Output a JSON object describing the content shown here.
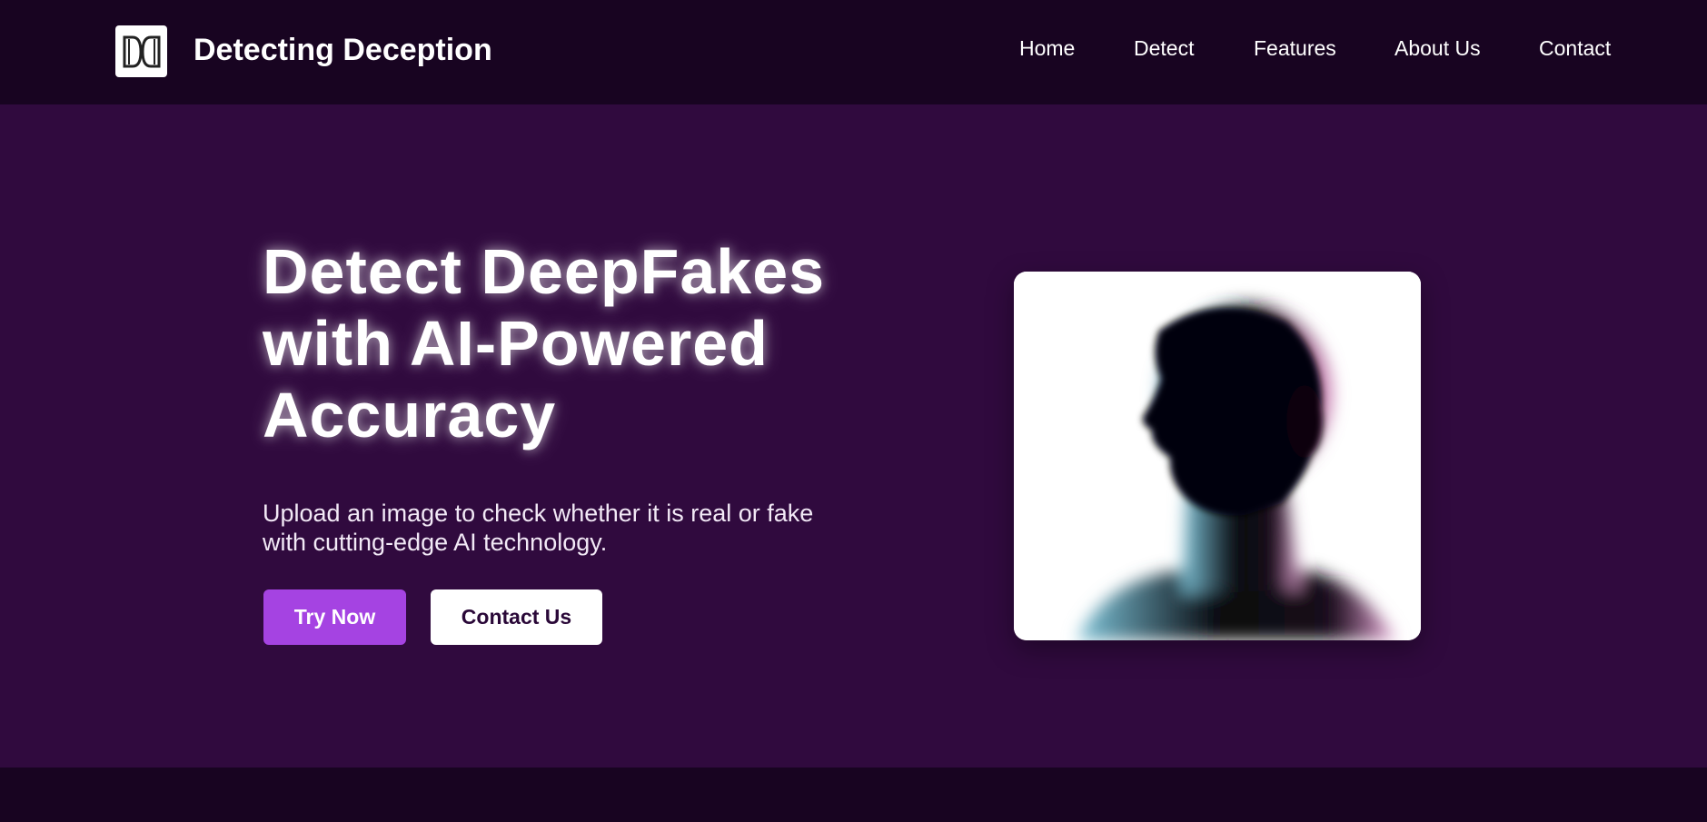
{
  "header": {
    "brand": "Detecting Deception",
    "logo_icon": "dd-monogram-icon",
    "nav": [
      {
        "label": "Home"
      },
      {
        "label": "Detect"
      },
      {
        "label": "Features"
      },
      {
        "label": "About Us"
      },
      {
        "label": "Contact"
      }
    ]
  },
  "hero": {
    "title_lines": [
      "Detect DeepFakes",
      "with AI-Powered",
      "Accuracy"
    ],
    "subtitle_lines": [
      "Upload an image to check whether it is real or fake",
      "with cutting-edge AI technology."
    ],
    "primary_button": "Try Now",
    "secondary_button": "Contact Us",
    "image_icon": "ai-head-illustration"
  },
  "colors": {
    "nav_bg": "#180421",
    "hero_bg": "#300a3e",
    "accent": "#a543e2",
    "secondary_button_text": "#2a0838"
  }
}
